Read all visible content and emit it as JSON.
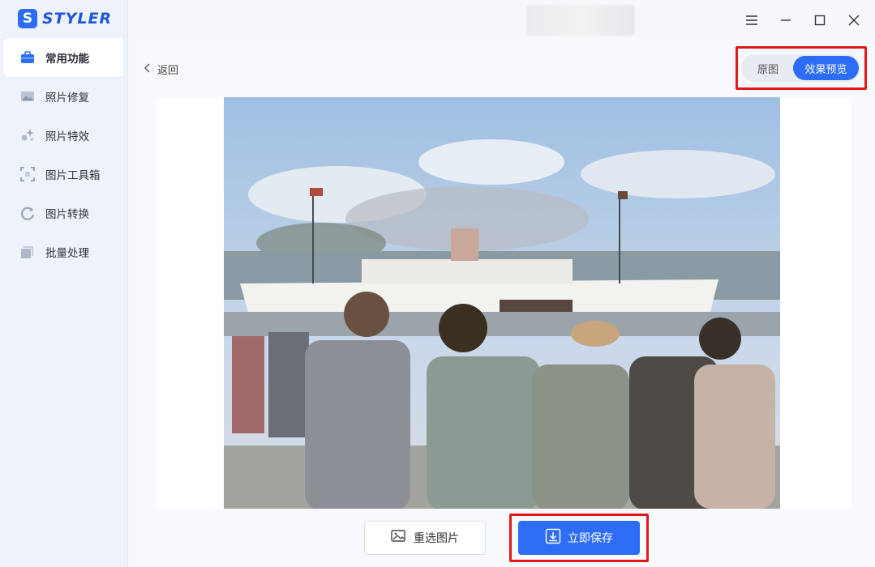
{
  "app": {
    "logo_letter": "S",
    "logo_text": "STYLER"
  },
  "sidebar": {
    "items": [
      {
        "label": "常用功能",
        "icon": "toolbox-icon",
        "active": true
      },
      {
        "label": "照片修复",
        "icon": "photo-repair-icon",
        "active": false
      },
      {
        "label": "照片特效",
        "icon": "sparkle-icon",
        "active": false
      },
      {
        "label": "图片工具箱",
        "icon": "toolbox-grid-icon",
        "active": false
      },
      {
        "label": "图片转换",
        "icon": "convert-icon",
        "active": false
      },
      {
        "label": "批量处理",
        "icon": "batch-icon",
        "active": false
      }
    ]
  },
  "header": {
    "back_label": "返回"
  },
  "compare_toggle": {
    "original_label": "原图",
    "preview_label": "效果预览",
    "selected": "效果预览"
  },
  "actions": {
    "reselect_label": "重选图片",
    "save_label": "立即保存"
  },
  "colors": {
    "accent": "#2d6df6",
    "highlight_box": "#e01a1a"
  }
}
